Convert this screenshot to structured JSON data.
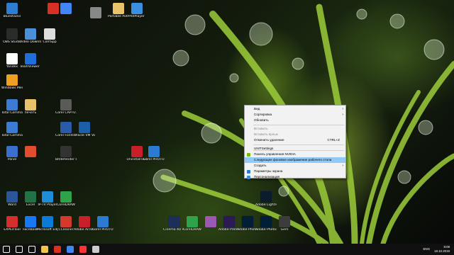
{
  "desktop_icons": [
    {
      "label": "Bluestacks",
      "color": "#2e7dd1",
      "icon": "bluestacks-icon"
    },
    {
      "label": "",
      "color": "#d93025",
      "icon": "opera-icon"
    },
    {
      "label": "",
      "color": "#4285f4",
      "icon": "chrome-icon"
    },
    {
      "label": "",
      "color": "#888888",
      "icon": "unknown-app-icon"
    },
    {
      "label": "Portable PotPlayer",
      "color": "#e8c36a",
      "icon": "folder-icon"
    },
    {
      "label": "PotPlayer",
      "color": "#3a8fe0",
      "icon": "potplayer-icon"
    },
    {
      "label": "OBS Studio",
      "color": "#2b2b2b",
      "icon": "obs-icon"
    },
    {
      "label": "Video Downloader",
      "color": "#4a90d9",
      "icon": "video-downloader-icon"
    },
    {
      "label": "ComSpp",
      "color": "#dddddd",
      "icon": "app-icon"
    },
    {
      "label": "Yandex",
      "color": "#ffffff",
      "icon": "yandex-icon"
    },
    {
      "label": "TeamViewer 14",
      "color": "#1e6fd9",
      "icon": "teamviewer-icon"
    },
    {
      "label": "Windows Media Player",
      "color": "#f0a020",
      "icon": "media-player-icon"
    },
    {
      "label": "Total Commander",
      "color": "#3b7bd4",
      "icon": "total-commander-icon"
    },
    {
      "label": "печать",
      "color": "#e8c36a",
      "icon": "folder-icon"
    },
    {
      "label": "Corel CAPTU...",
      "color": "#5a5a5a",
      "icon": "corel-capture-icon"
    },
    {
      "label": "Total Commander",
      "color": "#3b7bd4",
      "icon": "total-commander-icon"
    },
    {
      "label": "Corel Fonts Manag...",
      "color": "#2a5aa8",
      "icon": "corel-font-icon"
    },
    {
      "label": "Oracle VM VirtualBox",
      "color": "#1c5fa8",
      "icon": "virtualbox-icon"
    },
    {
      "label": "Panel",
      "color": "#3a6fd0",
      "icon": "panel-icon"
    },
    {
      "label": "",
      "color": "#e34c2c",
      "icon": "chrome-alt-icon"
    },
    {
      "label": "Bitdefender Font M...",
      "color": "#333333",
      "icon": "font-icon"
    },
    {
      "label": "UninstallTool",
      "color": "#c8202a",
      "icon": "uninstall-icon"
    },
    {
      "label": "Corel PHOTO...",
      "color": "#2a7bd1",
      "icon": "corel-photo-icon"
    },
    {
      "label": "Word",
      "color": "#2b579a",
      "icon": "word-icon"
    },
    {
      "label": "Excel",
      "color": "#217346",
      "icon": "excel-icon"
    },
    {
      "label": "IP-TV Player",
      "color": "#1f8dd6",
      "icon": "iptv-icon"
    },
    {
      "label": "CorelDRAW",
      "color": "#2ea34a",
      "icon": "coreldraw-icon"
    },
    {
      "label": "EXPERTool",
      "color": "#d32f2f",
      "icon": "expert-icon"
    },
    {
      "label": "Facebook",
      "color": "#1877f2",
      "icon": "facebook-icon"
    },
    {
      "label": "Microsoft Edge",
      "color": "#0a7bd7",
      "icon": "edge-icon"
    },
    {
      "label": "CCleaner",
      "color": "#d33a2c",
      "icon": "ccleaner-icon"
    },
    {
      "label": "Adobe Acrobat 9 Pro",
      "color": "#c8202a",
      "icon": "acrobat-icon"
    },
    {
      "label": "Corel PHOTO-PAI...",
      "color": "#2a7bd1",
      "icon": "corel-photo-icon"
    },
    {
      "label": "Cinema 4D R20",
      "color": "#1b2f5a",
      "icon": "cinema4d-icon"
    },
    {
      "label": "CorelDRAW",
      "color": "#2ea34a",
      "icon": "coreldraw-icon"
    },
    {
      "label": "",
      "color": "#9a59b5",
      "icon": "premiere-icon"
    },
    {
      "label": "Adobe Premiere",
      "color": "#2a1a55",
      "icon": "after-effects-icon"
    },
    {
      "label": "Adobe Photosh...",
      "color": "#001e36",
      "icon": "photoshop-icon"
    },
    {
      "label": "Adobe Lightroom",
      "color": "#0b1c2f",
      "icon": "lightroom-icon"
    },
    {
      "label": "Adobe Photosh...",
      "color": "#001e36",
      "icon": "photoshop-icon"
    },
    {
      "label": "Gem",
      "color": "#3c3c3c",
      "icon": "app-icon"
    }
  ],
  "context_menu": {
    "items": [
      {
        "label": "Вид",
        "shortcut": "",
        "submenu": true,
        "disabled": false,
        "highlight": false,
        "icon": ""
      },
      {
        "label": "Сортировка",
        "shortcut": "",
        "submenu": true,
        "disabled": false,
        "highlight": false,
        "icon": ""
      },
      {
        "label": "Обновить",
        "shortcut": "",
        "submenu": false,
        "disabled": false,
        "highlight": false,
        "icon": ""
      },
      {
        "label": "Вставить",
        "shortcut": "",
        "submenu": false,
        "disabled": true,
        "highlight": false,
        "icon": ""
      },
      {
        "label": "Вставить ярлык",
        "shortcut": "",
        "submenu": false,
        "disabled": true,
        "highlight": false,
        "icon": ""
      },
      {
        "label": "Отменить удаление",
        "shortcut": "CTRL+Z",
        "submenu": false,
        "disabled": false,
        "highlight": false,
        "icon": ""
      },
      {
        "label": "UNITSettings",
        "shortcut": "",
        "submenu": false,
        "disabled": false,
        "highlight": false,
        "icon": ""
      },
      {
        "label": "Панель управления NVIDIA",
        "shortcut": "",
        "submenu": false,
        "disabled": false,
        "highlight": false,
        "icon": "nvidia-icon"
      },
      {
        "label": "Следующее фоновое изображение рабочего стола",
        "shortcut": "",
        "submenu": false,
        "disabled": false,
        "highlight": true,
        "icon": ""
      },
      {
        "label": "Создать",
        "shortcut": "",
        "submenu": true,
        "disabled": false,
        "highlight": false,
        "icon": ""
      },
      {
        "label": "Параметры экрана",
        "shortcut": "",
        "submenu": false,
        "disabled": false,
        "highlight": false,
        "icon": "display-icon"
      },
      {
        "label": "Персонализация",
        "shortcut": "",
        "submenu": false,
        "disabled": false,
        "highlight": false,
        "icon": "personalize-icon"
      }
    ]
  },
  "taskbar": {
    "apps": [
      {
        "name": "start-button-icon",
        "color": "#ffffff"
      },
      {
        "name": "search-icon",
        "color": "#ffffff"
      },
      {
        "name": "task-view-icon",
        "color": "#ffffff"
      },
      {
        "name": "explorer-icon",
        "color": "#f2c14e"
      },
      {
        "name": "opera-icon",
        "color": "#d93025"
      },
      {
        "name": "chrome-icon",
        "color": "#4285f4"
      },
      {
        "name": "yandex-icon",
        "color": "#ff3333"
      },
      {
        "name": "settings-icon",
        "color": "#cccccc"
      }
    ],
    "language": "ENG",
    "time": "8:09",
    "date": "18.10.2019"
  },
  "colors": {
    "menu_bg": "#f2f2f2",
    "menu_highlight": "#91c9f7",
    "taskbar_bg": "#101010"
  }
}
